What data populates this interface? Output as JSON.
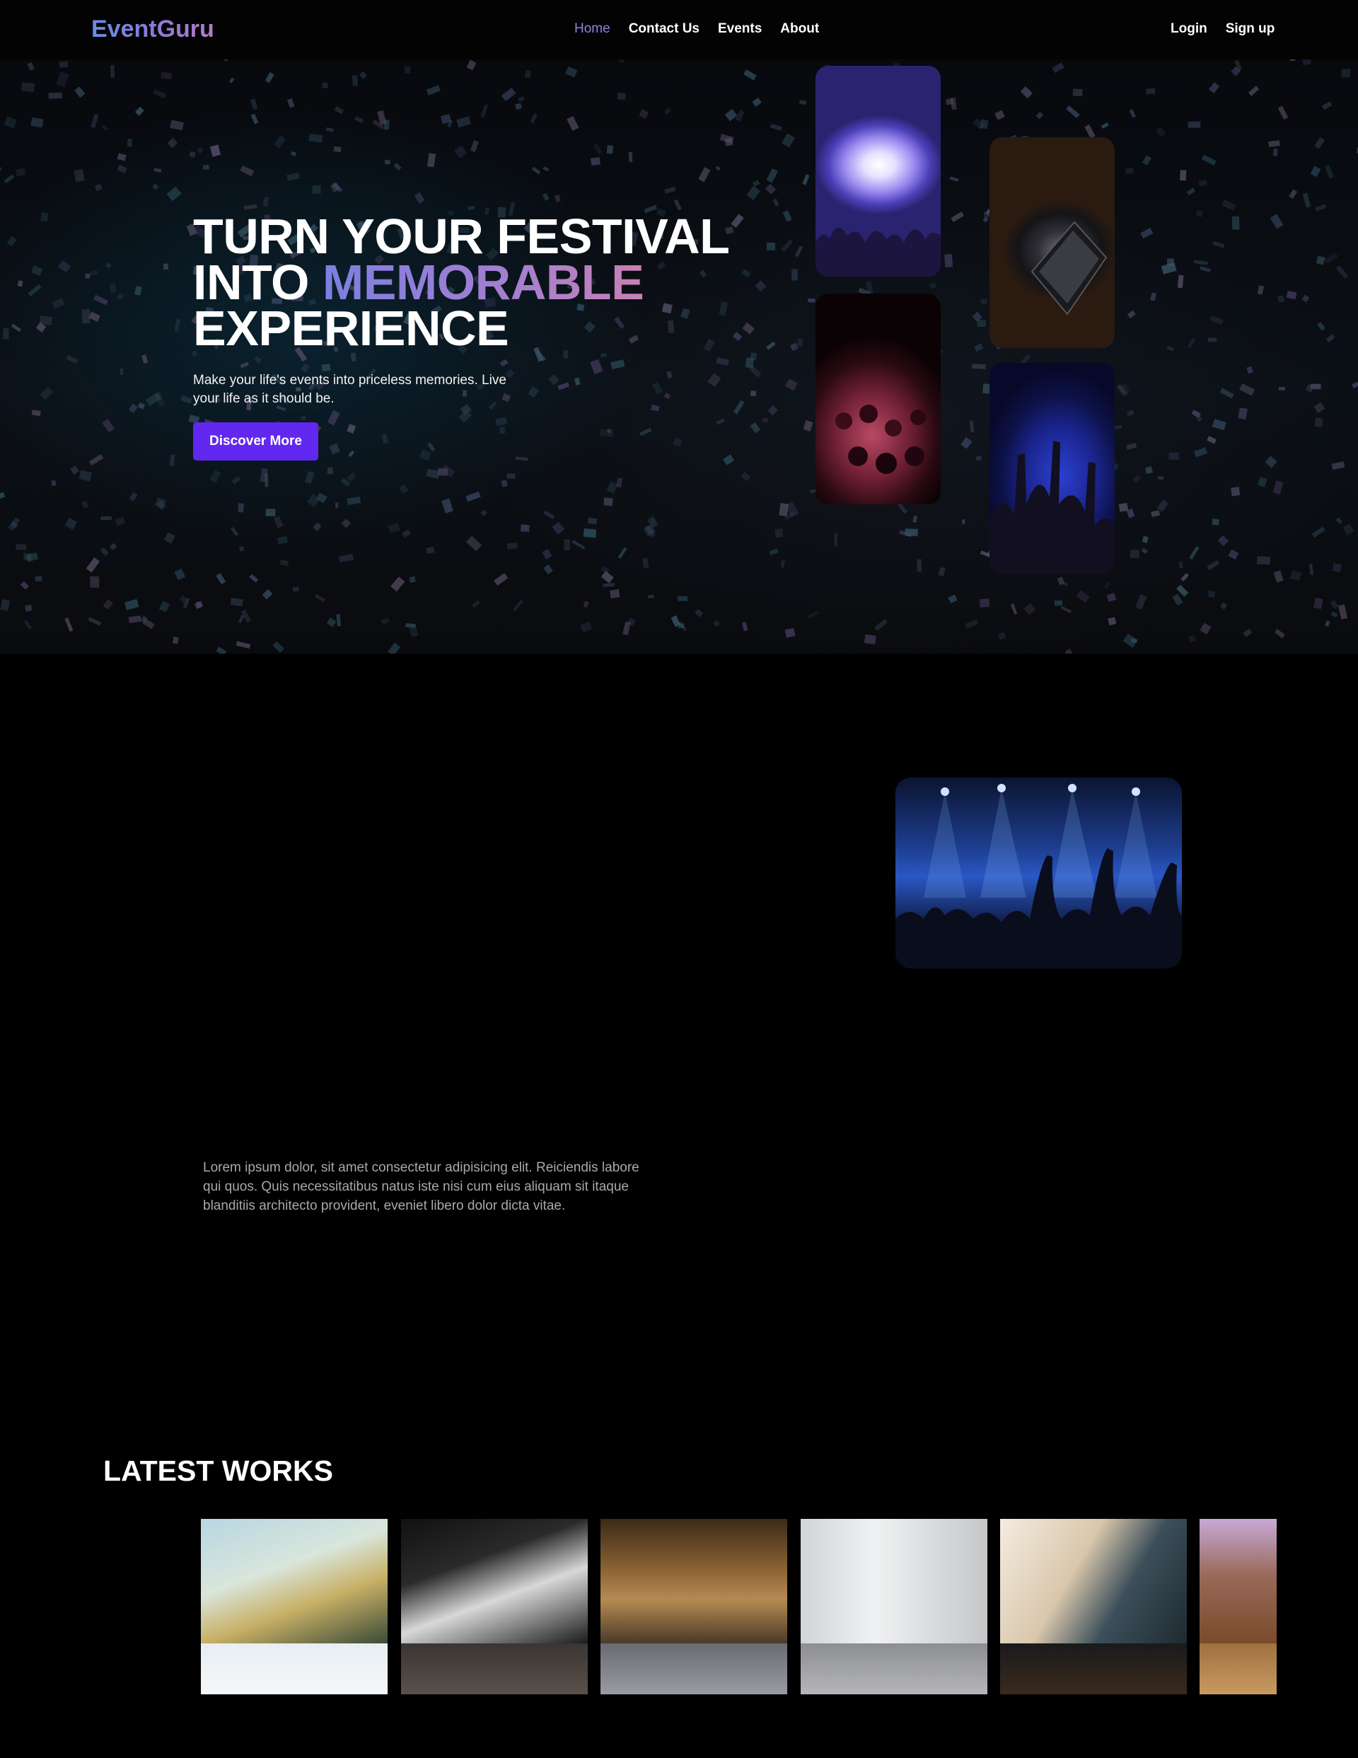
{
  "nav": {
    "logo": "EventGuru",
    "links": [
      {
        "label": "Home",
        "active": true
      },
      {
        "label": "Contact Us",
        "active": false
      },
      {
        "label": "Events",
        "active": false
      },
      {
        "label": "About",
        "active": false
      }
    ],
    "login": "Login",
    "signup": "Sign up"
  },
  "hero": {
    "title_line1": "TURN YOUR FESTIVAL",
    "title_line2_plain": "INTO ",
    "title_line2_highlight": "MEMORABLE",
    "title_line3": "EXPERIENCE",
    "subtitle": "Make your life's events into priceless memories. Live your life as it should be.",
    "cta_label": "Discover More"
  },
  "about": {
    "paragraph": "Lorem ipsum dolor, sit amet consectetur adipisicing elit. Reiciendis labore qui quos. Quis necessitatibus natus iste nisi cum eius aliquam sit itaque blanditiis architecto provident, eveniet libero dolor dicta vitae."
  },
  "latest_works": {
    "title": "LATEST WORKS"
  },
  "colors": {
    "accent": "#6228f0",
    "nav_active": "#8d85d8",
    "background": "#000000"
  }
}
